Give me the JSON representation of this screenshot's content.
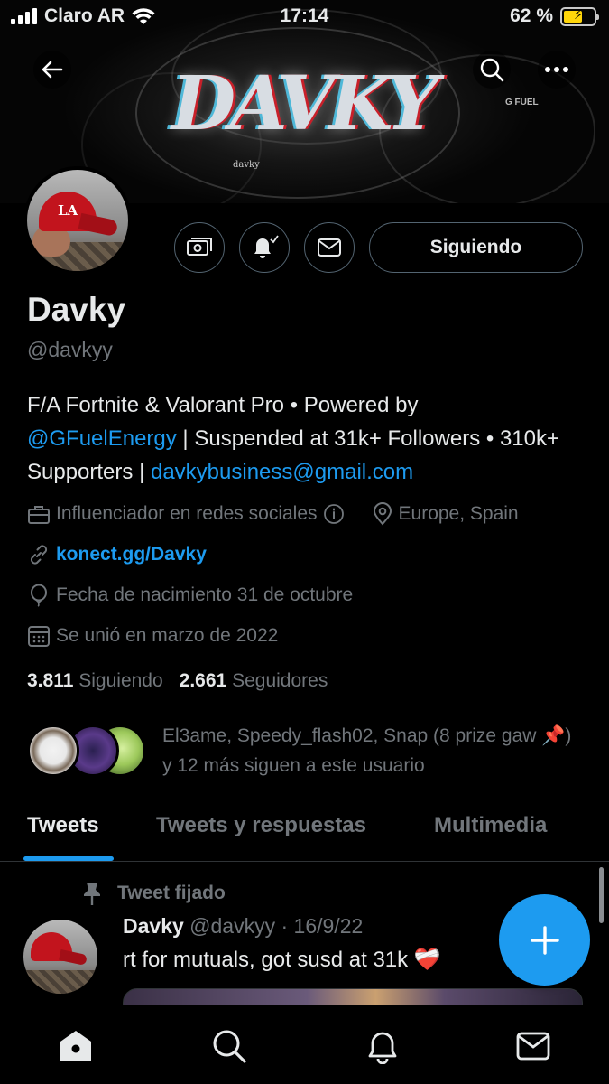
{
  "status_bar": {
    "carrier": "Claro AR",
    "time": "17:14",
    "battery_text": "62 %",
    "battery_level": 0.62,
    "icons": [
      "signal-icon",
      "wifi-icon",
      "battery-charging-icon"
    ]
  },
  "banner": {
    "logo_text": "DAVKY",
    "small_tag": "davky",
    "sponsor_tag": "G FUEL"
  },
  "profile": {
    "display_name": "Davky",
    "handle": "@davkyy",
    "bio_part1": "F/A Fortnite & Valorant Pro • Powered by",
    "bio_mention": "@GFuelEnergy",
    "bio_part2": " | Suspended at 31k+ Followers • 310k+ Supporters | ",
    "bio_email": "davkybusiness@gmail.com",
    "category": "Influenciador en redes sociales",
    "location": "Europe, Spain",
    "website": "konect.gg/Davky",
    "birthday": "Fecha de nacimiento 31 de octubre",
    "joined": "Se unió en marzo de 2022",
    "following_count": "3.811",
    "following_label": "Siguiendo",
    "followers_count": "2.661",
    "followers_label": "Seguidores",
    "mutuals_text": "El3ame, Speedy_flash02, Snap (8 prize gaw 📌) y 12 más siguen a este usuario"
  },
  "actions": {
    "follow_button_label": "Siguiendo"
  },
  "tabs": [
    {
      "label": "Tweets",
      "active": true
    },
    {
      "label": "Tweets y respuestas",
      "active": false
    },
    {
      "label": "Multimedia",
      "active": false
    }
  ],
  "pinned_tweet": {
    "pinned_label": "Tweet fijado",
    "author": "Davky",
    "handle_date": "@davkyy · 16/9/22",
    "text": "rt for mutuals, got susd at 31k ❤️‍🩹"
  },
  "colors": {
    "accent": "#1d9bf0",
    "background": "#000000",
    "muted_text": "#71767b"
  }
}
